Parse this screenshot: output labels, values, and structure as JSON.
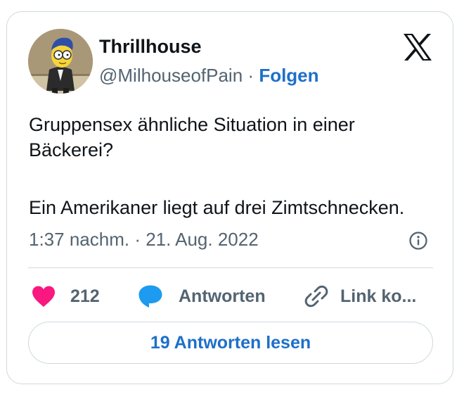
{
  "author": {
    "name": "Thrillhouse",
    "handle": "@MilhouseofPain",
    "separator": "·",
    "follow_label": "Folgen"
  },
  "tweet": {
    "lines": [
      "Gruppensex ähnliche Situation in einer",
      "Bäckerei?",
      "Ein Amerikaner liegt auf drei Zimtschnecken."
    ],
    "timestamp": "1:37 nachm. · 21. Aug. 2022"
  },
  "actions": {
    "like_count": "212",
    "reply_label": "Antworten",
    "copy_link_label": "Link ko..."
  },
  "read_replies_label": "19 Antworten lesen",
  "icons": {
    "x_logo": "x-logo-icon",
    "info": "info-icon",
    "heart": "heart-icon",
    "reply": "speech-bubble-icon",
    "link": "link-icon"
  },
  "colors": {
    "accent": "#1d70c9",
    "heart": "#f91880",
    "reply_bubble": "#1d9bf0",
    "secondary_text": "#536471",
    "border": "#cfd9de"
  }
}
